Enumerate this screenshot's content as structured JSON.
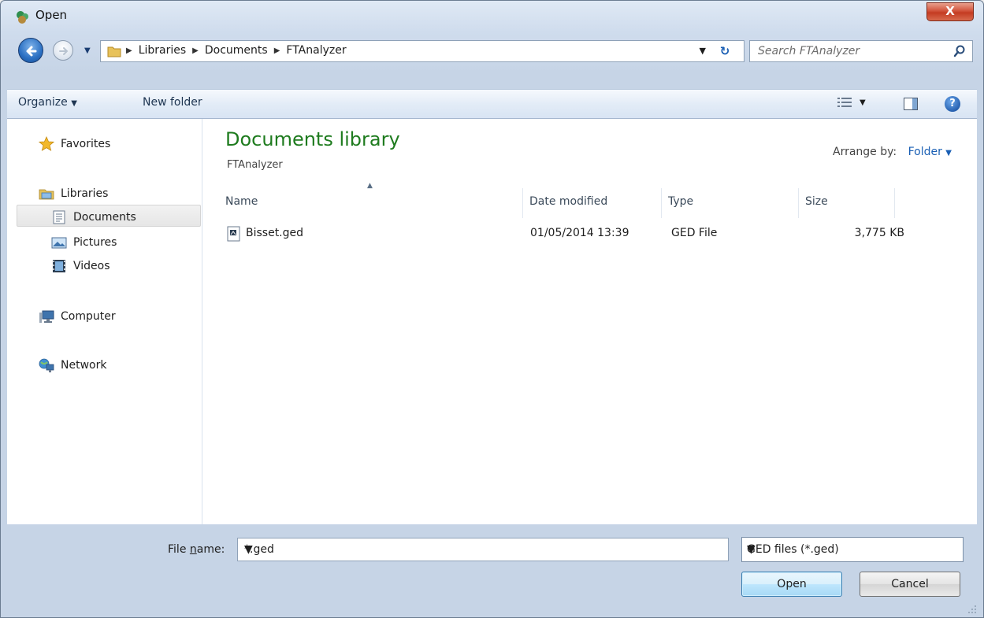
{
  "window": {
    "title": "Open",
    "close_glyph": "X"
  },
  "address": {
    "crumbs": [
      "Libraries",
      "Documents",
      "FTAnalyzer"
    ],
    "search_placeholder": "Search FTAnalyzer"
  },
  "toolbar": {
    "organize_label": "Organize",
    "new_folder_label": "New folder"
  },
  "navigation": {
    "favorites": "Favorites",
    "libraries": "Libraries",
    "documents": "Documents",
    "pictures": "Pictures",
    "videos": "Videos",
    "computer": "Computer",
    "network": "Network"
  },
  "library": {
    "title": "Documents library",
    "subtitle": "FTAnalyzer",
    "arrange_label": "Arrange by:",
    "arrange_value": "Folder"
  },
  "columns": {
    "name": "Name",
    "date_modified": "Date modified",
    "type": "Type",
    "size": "Size"
  },
  "files": [
    {
      "name": "Bisset.ged",
      "date_modified": "01/05/2014 13:39",
      "type": "GED File",
      "size": "3,775 KB"
    }
  ],
  "footer": {
    "file_name_label_pre": "File ",
    "file_name_label_underlined": "n",
    "file_name_label_post": "ame:",
    "file_name_value": "*.ged",
    "filter_value": "GED files (*.ged)",
    "open_label": "Open",
    "cancel_label": "Cancel"
  },
  "colors": {
    "library_title": "#1e7b1e",
    "link_blue": "#1a5fb4",
    "close_red": "#c43b22"
  }
}
